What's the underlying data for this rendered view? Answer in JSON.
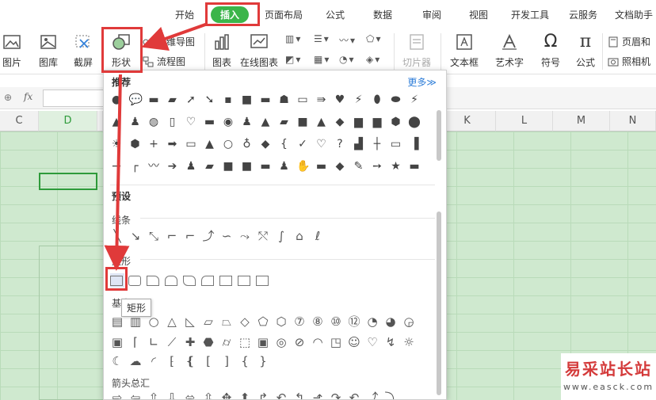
{
  "tabs": [
    "开始",
    "插入",
    "页面布局",
    "公式",
    "数据",
    "审阅",
    "视图",
    "开发工具",
    "云服务",
    "文档助手"
  ],
  "ribbon": {
    "picture": "图片",
    "gallery": "图库",
    "screenshot": "截屏",
    "shape": "形状",
    "mindmap": "思维导图",
    "flowchart": "流程图",
    "chart": "图表",
    "online_chart": "在线图表",
    "slicer": "切片器",
    "textbox": "文本框",
    "wordart": "艺术字",
    "symbol": "符号",
    "formula": "公式",
    "header_footer": "页眉和",
    "camera": "照相机"
  },
  "formula_bar": {
    "fx": "fx"
  },
  "columns": [
    "C",
    "D",
    "K",
    "L",
    "M",
    "N"
  ],
  "panel": {
    "recommend": "推荐",
    "more": "更多≫",
    "preset": "预设",
    "lines": "线条",
    "rect": "矩形",
    "basic": "基本",
    "arrows": "箭头总汇"
  },
  "tooltip": "矩形",
  "watermark": {
    "title": "易采站长站",
    "url": "www.easck.com"
  },
  "colors": {
    "accent_green": "#3bb54a",
    "annotation_red": "#e03a3a",
    "sheet_green": "#cfe9cf"
  }
}
